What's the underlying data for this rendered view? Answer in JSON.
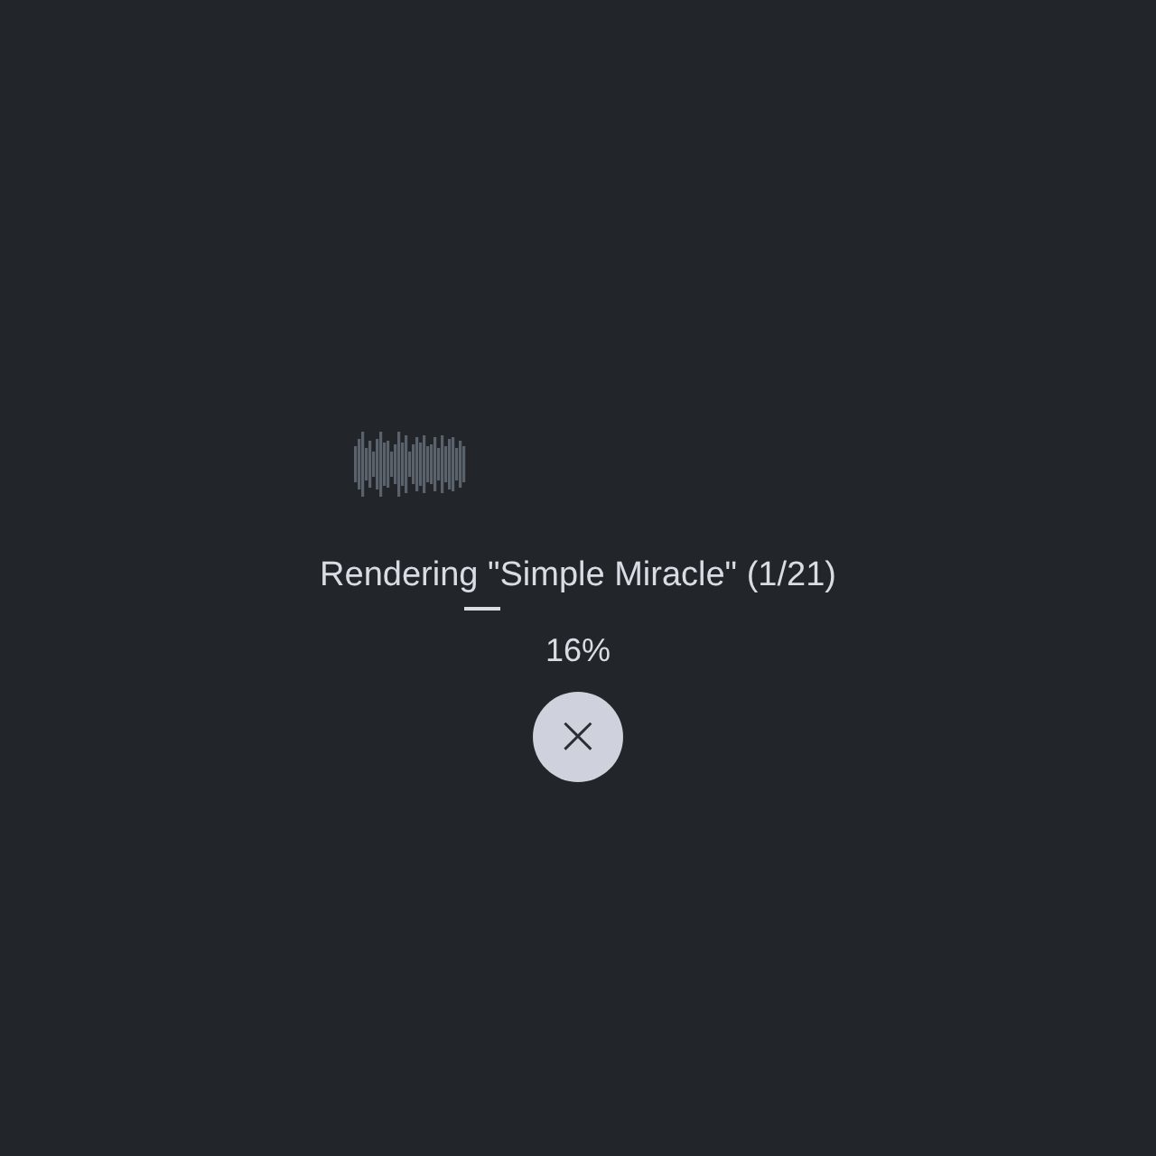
{
  "status": {
    "title": "Rendering \"Simple Miracle\" (1/21)",
    "percent": "16%"
  },
  "cancel_button": {
    "icon": "×"
  }
}
